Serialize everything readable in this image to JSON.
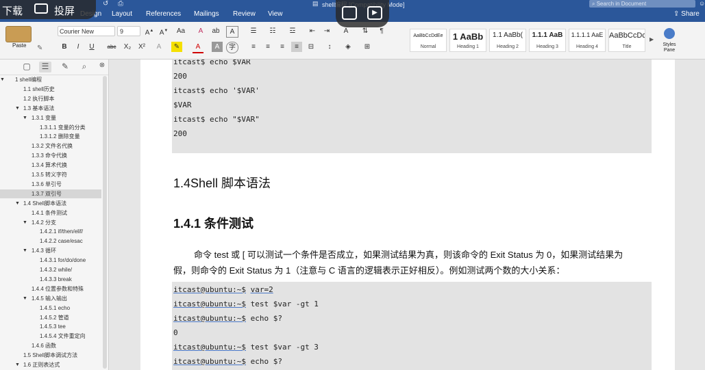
{
  "window": {
    "title": "shell编程 [Compatibility Mode]"
  },
  "overlay": {
    "download": "下载",
    "cast": "投屏"
  },
  "ribbon": {
    "tabs": [
      "Design",
      "Layout",
      "References",
      "Mailings",
      "Review",
      "View"
    ],
    "search_placeholder": "Search in Document",
    "share": "Share",
    "paste": "Paste",
    "font_name": "Courier New",
    "font_size": "9",
    "styles": [
      {
        "preview": "AaBbCcDdEe",
        "name": "Normal"
      },
      {
        "preview": "1 AaBb",
        "name": "Heading 1"
      },
      {
        "preview": "1.1 AaBb(",
        "name": "Heading 2"
      },
      {
        "preview": "1.1.1 AaB",
        "name": "Heading 3"
      },
      {
        "preview": "1.1.1.1 AaE",
        "name": "Heading 4"
      },
      {
        "preview": "AaBbCcDc",
        "name": "Title"
      }
    ],
    "styles_pane": "Styles Pane"
  },
  "outline": [
    {
      "text": "1 shell编程",
      "level": 0,
      "arrow": "▼"
    },
    {
      "text": "1.1 shell历史",
      "level": 1,
      "arrow": ""
    },
    {
      "text": "1.2 执行脚本",
      "level": 1,
      "arrow": ""
    },
    {
      "text": "1.3 基本语法",
      "level": 1,
      "arrow": "▼"
    },
    {
      "text": "1.3.1 变量",
      "level": 2,
      "arrow": "▼"
    },
    {
      "text": "1.3.1.1 变量的分类",
      "level": 3,
      "arrow": ""
    },
    {
      "text": "1.3.1.2 删除变量",
      "level": 3,
      "arrow": ""
    },
    {
      "text": "1.3.2 文件名代换",
      "level": 2,
      "arrow": ""
    },
    {
      "text": "1.3.3 命令代换",
      "level": 2,
      "arrow": ""
    },
    {
      "text": "1.3.4 算术代换",
      "level": 2,
      "arrow": ""
    },
    {
      "text": "1.3.5 转义字符",
      "level": 2,
      "arrow": ""
    },
    {
      "text": "1.3.6 单引号",
      "level": 2,
      "arrow": ""
    },
    {
      "text": "1.3.7 双引号",
      "level": 2,
      "arrow": "",
      "selected": true
    },
    {
      "text": "1.4 Shell脚本语法",
      "level": 1,
      "arrow": "▼"
    },
    {
      "text": "1.4.1 条件测试",
      "level": 2,
      "arrow": ""
    },
    {
      "text": "1.4.2 分支",
      "level": 2,
      "arrow": "▼"
    },
    {
      "text": "1.4.2.1 if/then/elif/",
      "level": 3,
      "arrow": ""
    },
    {
      "text": "1.4.2.2 case/esac",
      "level": 3,
      "arrow": ""
    },
    {
      "text": "1.4.3 循环",
      "level": 2,
      "arrow": "▼"
    },
    {
      "text": "1.4.3.1 for/do/done",
      "level": 3,
      "arrow": ""
    },
    {
      "text": "1.4.3.2 while/",
      "level": 3,
      "arrow": ""
    },
    {
      "text": "1.4.3.3 break",
      "level": 3,
      "arrow": ""
    },
    {
      "text": "1.4.4 位置参数和特殊",
      "level": 2,
      "arrow": ""
    },
    {
      "text": "1.4.5 输入输出",
      "level": 2,
      "arrow": "▼"
    },
    {
      "text": "1.4.5.1 echo",
      "level": 3,
      "arrow": ""
    },
    {
      "text": "1.4.5.2 管道",
      "level": 3,
      "arrow": ""
    },
    {
      "text": "1.4.5.3 tee",
      "level": 3,
      "arrow": ""
    },
    {
      "text": "1.4.5.4 文件重定向",
      "level": 3,
      "arrow": ""
    },
    {
      "text": "1.4.6 函数",
      "level": 2,
      "arrow": ""
    },
    {
      "text": "1.5 Shell脚本调试方法",
      "level": 1,
      "arrow": ""
    },
    {
      "text": "1.6 正则表达式",
      "level": 1,
      "arrow": "▼"
    }
  ],
  "doc": {
    "code1": [
      "itcast$ echo $VAR",
      "200",
      "itcast$ echo '$VAR'",
      "$VAR",
      "itcast$ echo \"$VAR\"",
      "200"
    ],
    "heading_14": "1.4Shell 脚本语法",
    "heading_141": "1.4.1 条件测试",
    "para_line1": "命令 test 或 [ 可以测试一个条件是否成立，如果测试结果为真，则该命令的 Exit Status 为 0，如果测试结果为",
    "para_line2": "假，则命令的 Exit Status 为 1（注意与 C 语言的逻辑表示正好相反）。例如测试两个数的大小关系：",
    "code2": [
      {
        "prompt": "itcast@ubuntu:~$",
        "cmd": "var=2"
      },
      {
        "prompt": "itcast@ubuntu:~$",
        "cmd": "test $var -gt 1"
      },
      {
        "prompt": "itcast@ubuntu:~$",
        "cmd": "echo $?"
      },
      {
        "prompt": "",
        "cmd": "0"
      },
      {
        "prompt": "itcast@ubuntu:~$",
        "cmd": "test $var -gt 3"
      },
      {
        "prompt": "itcast@ubuntu:~$",
        "cmd": "echo $?"
      }
    ]
  }
}
